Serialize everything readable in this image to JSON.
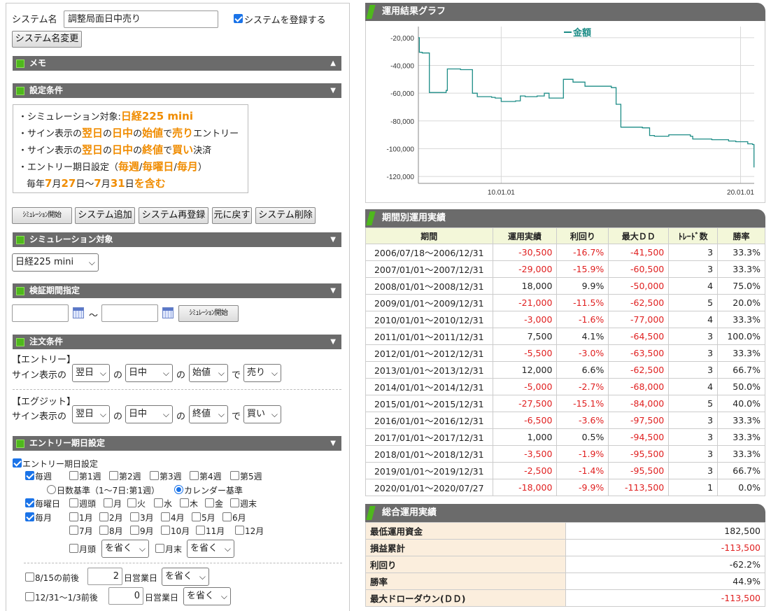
{
  "left": {
    "sysname_label": "システム名",
    "sysname_value": "調整局面日中売り",
    "register_label": "システムを登録する",
    "rename_button": "システム名変更",
    "memo_title": "メモ",
    "settings_title": "設定条件",
    "cond": {
      "l1_pre": "・シミュレーション対象:",
      "l1_val": "日経225 mini",
      "l2_a": "・サイン表示の",
      "l2_b": "翌日",
      "l2_c": "の",
      "l2_d": "日中",
      "l2_e": "の",
      "l2_f": "始値",
      "l2_g": "で",
      "l2_h": "売り",
      "l2_i": "エントリー",
      "l3_a": "・サイン表示の",
      "l3_b": "翌日",
      "l3_c": "の",
      "l3_d": "日中",
      "l3_e": "の",
      "l3_f": "終値",
      "l3_g": "で",
      "l3_h": "買い",
      "l3_i": "決済",
      "l4_a": "・エントリー期日設定（",
      "l4_b": "毎週",
      "l4_c": "/",
      "l4_d": "毎曜日",
      "l4_e": "/",
      "l4_f": "毎月",
      "l4_g": "）",
      "l5_a": "毎年",
      "l5_b": "7",
      "l5_c": "月",
      "l5_d": "27",
      "l5_e": "日～",
      "l5_f": "7",
      "l5_g": "月",
      "l5_h": "31",
      "l5_i": "日",
      "l5_j": "を含む"
    },
    "action_buttons": [
      "ｼﾐｭﾚｰｼｮﾝ開始",
      "システム追加",
      "システム再登録",
      "元に戻す",
      "システム削除"
    ],
    "sim_target_title": "シミュレーション対象",
    "sim_target_value": "日経225 mini",
    "period_title": "検証期間指定",
    "period_sep": "～",
    "period_button": "ｼﾐｭﾚｰｼｮﾝ開始",
    "order_title": "注文条件",
    "entry_label": "【エントリー】",
    "exit_label": "【エグジット】",
    "sign_label": "サイン表示の",
    "no": "の",
    "de": "で",
    "entry": {
      "day": "翌日",
      "session": "日中",
      "price": "始値",
      "side": "売り"
    },
    "exit": {
      "day": "翌日",
      "session": "日中",
      "price": "終値",
      "side": "買い"
    },
    "entry_date_title": "エントリー期日設定",
    "entry_date_check": "エントリー期日設定",
    "weekly": "毎週",
    "weeks": [
      "第1週",
      "第2週",
      "第3週",
      "第4週",
      "第5週"
    ],
    "basis_days": "日数基準（1～7日:第1週）",
    "basis_cal": "カレンダー基準",
    "weekday": "毎曜日",
    "weekdays": [
      "週頭",
      "月",
      "火",
      "水",
      "木",
      "金",
      "週末"
    ],
    "monthly": "毎月",
    "months1": [
      "1月",
      "2月",
      "3月",
      "4月",
      "5月",
      "6月"
    ],
    "months2": [
      "7月",
      "8月",
      "9月",
      "10月",
      "11月",
      "12月"
    ],
    "month_start": "月頭",
    "month_end": "月末",
    "omit": "を省く",
    "obon_label": "8/15の前後",
    "obon_value": "2",
    "newyear_label": "12/31～1/3前後",
    "newyear_value": "0",
    "bizday": "日営業日"
  },
  "right": {
    "graph_title": "運用結果グラフ",
    "period_title": "期間別運用実績",
    "summary_title": "総合運用実績",
    "period_headers": [
      "期間",
      "運用実績",
      "利回り",
      "最大ＤＤ",
      "ﾄﾚｰﾄﾞ数",
      "勝率"
    ],
    "period_rows": [
      [
        "2006/07/18～2006/12/31",
        "-30,500",
        "-16.7%",
        "-41,500",
        "3",
        "33.3%"
      ],
      [
        "2007/01/01～2007/12/31",
        "-29,000",
        "-15.9%",
        "-60,500",
        "3",
        "33.3%"
      ],
      [
        "2008/01/01～2008/12/31",
        "18,000",
        "9.9%",
        "-50,000",
        "4",
        "75.0%"
      ],
      [
        "2009/01/01～2009/12/31",
        "-21,000",
        "-11.5%",
        "-62,500",
        "5",
        "20.0%"
      ],
      [
        "2010/01/01～2010/12/31",
        "-3,000",
        "-1.6%",
        "-77,000",
        "4",
        "33.3%"
      ],
      [
        "2011/01/01～2011/12/31",
        "7,500",
        "4.1%",
        "-64,500",
        "3",
        "100.0%"
      ],
      [
        "2012/01/01～2012/12/31",
        "-5,500",
        "-3.0%",
        "-63,500",
        "3",
        "33.3%"
      ],
      [
        "2013/01/01～2013/12/31",
        "12,000",
        "6.6%",
        "-62,500",
        "3",
        "66.7%"
      ],
      [
        "2014/01/01～2014/12/31",
        "-5,000",
        "-2.7%",
        "-68,000",
        "4",
        "50.0%"
      ],
      [
        "2015/01/01～2015/12/31",
        "-27,500",
        "-15.1%",
        "-84,000",
        "5",
        "40.0%"
      ],
      [
        "2016/01/01～2016/12/31",
        "-6,500",
        "-3.6%",
        "-97,500",
        "3",
        "33.3%"
      ],
      [
        "2017/01/01～2017/12/31",
        "1,000",
        "0.5%",
        "-94,500",
        "3",
        "33.3%"
      ],
      [
        "2018/01/01～2018/12/31",
        "-3,500",
        "-1.9%",
        "-95,500",
        "3",
        "33.3%"
      ],
      [
        "2019/01/01～2019/12/31",
        "-2,500",
        "-1.4%",
        "-95,500",
        "3",
        "66.7%"
      ],
      [
        "2020/01/01～2020/07/27",
        "-18,000",
        "-9.9%",
        "-113,500",
        "1",
        "0.0%"
      ]
    ],
    "summary_rows": [
      [
        "最低運用資金",
        "182,500"
      ],
      [
        "損益累計",
        "-113,500"
      ],
      [
        "利回り",
        "-62.2%"
      ],
      [
        "勝率",
        "44.9%"
      ],
      [
        "最大ドローダウン(ＤＤ)",
        "-113,500"
      ]
    ]
  },
  "colors": {
    "accent_orange": "#f08c00",
    "negative": "#e02020",
    "line": "#1c8c86",
    "header_bg": "#6b6b6b",
    "green": "#4fb81d"
  },
  "chart_data": {
    "type": "line",
    "title": "",
    "series": [
      {
        "name": "金額",
        "x": [
          2006.54,
          2006.58,
          2006.7,
          2006.95,
          2007.0,
          2007.3,
          2007.7,
          2007.75,
          2008.1,
          2008.3,
          2008.8,
          2009.0,
          2009.3,
          2009.6,
          2009.75,
          2010.0,
          2010.3,
          2010.6,
          2010.8,
          2011.0,
          2011.5,
          2011.8,
          2012.0,
          2012.4,
          2012.6,
          2013.0,
          2013.5,
          2014.0,
          2014.6,
          2014.8,
          2015.0,
          2015.5,
          2015.9,
          2016.2,
          2016.4,
          2016.9,
          2017.0,
          2017.3,
          2017.9,
          2018.0,
          2018.4,
          2018.8,
          2019.0,
          2019.5,
          2019.8,
          2020.0,
          2020.3,
          2020.5,
          2020.56
        ],
        "y": [
          -20000,
          -30500,
          -31000,
          -31000,
          -59500,
          -59500,
          -58000,
          -42500,
          -42500,
          -43000,
          -60000,
          -62500,
          -62500,
          -63000,
          -63500,
          -66000,
          -66000,
          -65500,
          -62000,
          -62500,
          -62000,
          -60000,
          -63500,
          -63500,
          -50000,
          -52000,
          -55000,
          -55000,
          -56000,
          -68000,
          -84500,
          -84500,
          -85000,
          -90500,
          -91000,
          -91000,
          -90000,
          -90000,
          -91000,
          -93000,
          -93000,
          -93500,
          -93500,
          -94500,
          -95000,
          -95000,
          -96500,
          -97000,
          -113500
        ]
      }
    ],
    "xlim": [
      2006.54,
      2020.57
    ],
    "ylim": [
      -125000,
      -12000
    ],
    "yticks": [
      -20000,
      -40000,
      -60000,
      -80000,
      -100000,
      -120000
    ],
    "ytick_labels": [
      "-20,000",
      "-40,000",
      "-60,000",
      "-80,000",
      "-100,000",
      "-120,000"
    ],
    "xticks": [
      2010.0,
      2020.0
    ],
    "xtick_labels": [
      "10.01.01",
      "20.01.01"
    ],
    "grid": true,
    "legend": "top-center"
  }
}
